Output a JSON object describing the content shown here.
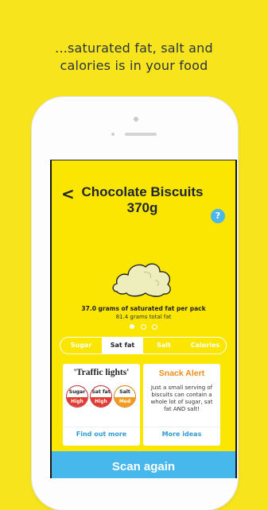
{
  "headline": {
    "line1": "...saturated fat, salt and",
    "line2": "calories is in your food"
  },
  "screen": {
    "back_icon": "chevron-left-icon",
    "title_line1": "Chocolate Biscuits",
    "title_line2": "370g",
    "help_label": "?",
    "fat_primary": "37.0 grams of saturated fat per pack",
    "fat_secondary": "81.4 grams total fat",
    "carousel": {
      "active_index": 0,
      "count": 3
    },
    "tabs": [
      {
        "label": "Sugar",
        "active": false
      },
      {
        "label": "Sat fat",
        "active": true
      },
      {
        "label": "Salt",
        "active": false
      },
      {
        "label": "Calories",
        "active": false
      }
    ],
    "card_traffic": {
      "title": "'Traffic lights'",
      "badges": [
        {
          "name": "Sugar",
          "level": "High",
          "color": "#e23b2f"
        },
        {
          "name": "Sat fat",
          "level": "High",
          "color": "#e23b2f"
        },
        {
          "name": "Salt",
          "level": "Med",
          "color": "#f39b1c"
        }
      ],
      "link": "Find out more"
    },
    "card_snack": {
      "title": "Snack Alert",
      "body_lines": [
        "Just a small serving of",
        "biscuits can contain a",
        "whole lot of sugar, sat",
        "fat AND salt!"
      ],
      "link": "More ideas"
    },
    "scan_button": "Scan again"
  },
  "colors": {
    "background": "#f7e41c",
    "screen": "#fae600",
    "accent_blue": "#47b8ec",
    "alert_orange": "#f08a1a"
  }
}
